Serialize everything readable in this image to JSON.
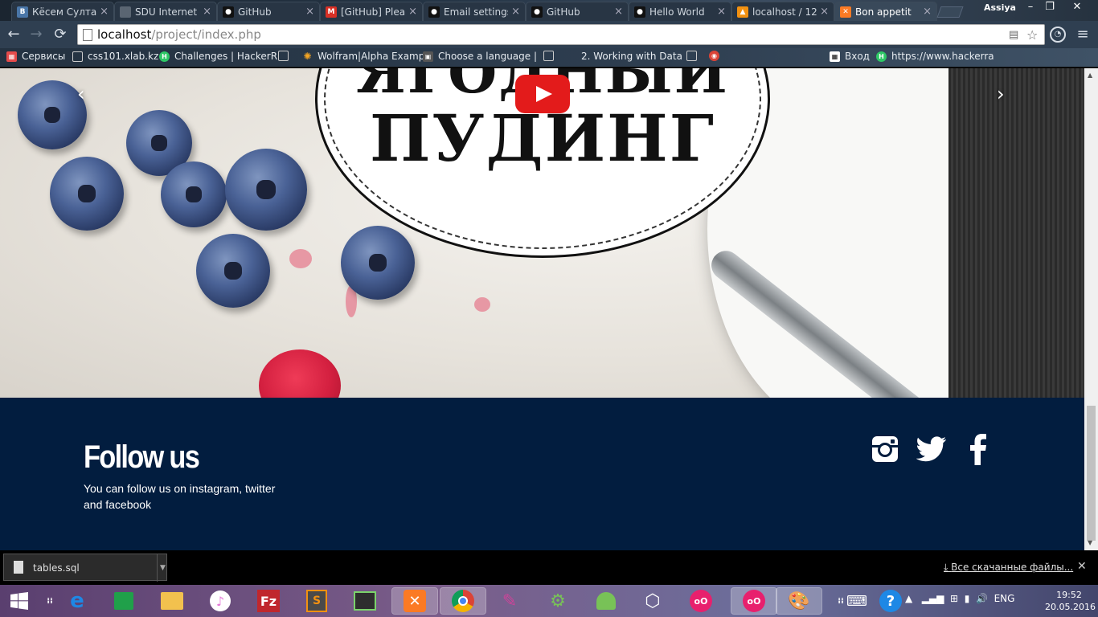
{
  "browser": {
    "tabs": [
      {
        "title": "Кёсем Султан",
        "icon": "vk-icon",
        "color": "#4a76a8",
        "glyph": "B"
      },
      {
        "title": "SDU Internet",
        "icon": "page-icon",
        "color": "#777777",
        "glyph": ""
      },
      {
        "title": "GitHub",
        "icon": "github-icon",
        "color": "#333333",
        "glyph": "●"
      },
      {
        "title": "[GitHub] Please",
        "icon": "gmail-icon",
        "color": "#d93025",
        "glyph": "M"
      },
      {
        "title": "Email settings",
        "icon": "github-icon",
        "color": "#333333",
        "glyph": "●"
      },
      {
        "title": "GitHub",
        "icon": "github-icon",
        "color": "#333333",
        "glyph": "●"
      },
      {
        "title": "Hello World",
        "icon": "github-icon",
        "color": "#333333",
        "glyph": "●"
      },
      {
        "title": "localhost / 12",
        "icon": "phpmyadmin-icon",
        "color": "#f29111",
        "glyph": "▲"
      },
      {
        "title": "Bon appetit",
        "icon": "xampp-icon",
        "color": "#fb7a24",
        "glyph": "✕"
      }
    ],
    "user": "Assiya",
    "window_buttons": [
      "–",
      "❐",
      "✕"
    ],
    "nav": {
      "back": "←",
      "forward": "→",
      "reload": "⟳"
    },
    "address": {
      "host": "localhost",
      "path": "/project/index.php"
    },
    "bookmarks": [
      {
        "label": "Сервисы",
        "icon": "apps-grid-icon",
        "color": "#e54b4b",
        "glyph": "▦"
      },
      {
        "label": "css101.xlab.kz",
        "icon": "page-icon",
        "color": "#888888",
        "glyph": ""
      },
      {
        "label": "Challenges | HackerR",
        "icon": "hackerrank-icon",
        "color": "#2ec866",
        "glyph": "H"
      },
      {
        "label": "",
        "icon": "page-icon",
        "color": "#888888",
        "glyph": ""
      },
      {
        "label": "Wolfram|Alpha Examp",
        "icon": "wolfram-icon",
        "color": "#f5a623",
        "glyph": "✺"
      },
      {
        "label": "Choose a language |",
        "icon": "duolingo-book-icon",
        "color": "#666666",
        "glyph": "▣"
      },
      {
        "label": "",
        "icon": "page-icon",
        "color": "#888888",
        "glyph": ""
      },
      {
        "label": "2. Working with Data",
        "icon": "page-icon",
        "color": "#888888",
        "glyph": ""
      },
      {
        "label": "",
        "icon": "page-icon",
        "color": "#888888",
        "glyph": ""
      },
      {
        "label": "",
        "icon": "chrome-icon",
        "color": "#db4437",
        "glyph": "◉"
      },
      {
        "label": "Вход",
        "icon": "grid-icon",
        "color": "#333333",
        "glyph": "▦"
      },
      {
        "label": "https://www.hackerra",
        "icon": "hackerrank-icon",
        "color": "#2ec866",
        "glyph": "H"
      }
    ]
  },
  "page": {
    "hero": {
      "title_line1": "ЯГОДНЫЙ",
      "title_line2": "ПУДИНГ",
      "prev_arrow": "‹",
      "next_arrow": "›"
    },
    "footer": {
      "title": "Follow us",
      "text": "You can follow us on instagram, twitter and facebook",
      "social": [
        {
          "name": "instagram",
          "icon": "instagram-icon"
        },
        {
          "name": "twitter",
          "icon": "twitter-icon"
        },
        {
          "name": "facebook",
          "icon": "facebook-icon"
        }
      ]
    }
  },
  "downloads": {
    "file": "tables.sql",
    "show_all": "Все скачанные файлы...",
    "close": "✕"
  },
  "taskbar": {
    "apps": [
      {
        "name": "start",
        "icon": "windows-start-icon",
        "color": "#ffffff"
      },
      {
        "name": "task-view",
        "icon": "task-view-icon",
        "color": "#ffffff"
      },
      {
        "name": "internet-explorer",
        "icon": "ie-icon",
        "color": "#1e88e5"
      },
      {
        "name": "store",
        "icon": "store-icon",
        "color": "#20a04a"
      },
      {
        "name": "file-explorer",
        "icon": "folder-icon",
        "color": "#f2c14e"
      },
      {
        "name": "itunes",
        "icon": "itunes-icon",
        "color": "#e67ad8"
      },
      {
        "name": "filezilla",
        "icon": "filezilla-icon",
        "color": "#c0272d"
      },
      {
        "name": "sublime-text",
        "icon": "sublime-icon",
        "color": "#4a4a4a"
      },
      {
        "name": "terminal",
        "icon": "terminal-icon",
        "color": "#2e2e2e"
      },
      {
        "name": "xampp",
        "icon": "xampp-icon",
        "color": "#fb7a24"
      },
      {
        "name": "chrome",
        "icon": "chrome-icon",
        "color": "#db4437"
      },
      {
        "name": "paint-app",
        "icon": "paint-icon",
        "color": "#cc4499"
      },
      {
        "name": "android-studio",
        "icon": "android-studio-icon",
        "color": "#78c257"
      },
      {
        "name": "android",
        "icon": "android-icon",
        "color": "#78c257"
      },
      {
        "name": "virtualbox",
        "icon": "virtualbox-icon",
        "color": "#2d5fa3"
      },
      {
        "name": "flickr-like",
        "icon": "dots-icon",
        "color": "#e8206d"
      },
      {
        "name": "flickr-like-2",
        "icon": "dots-icon",
        "color": "#e8206d"
      },
      {
        "name": "paint",
        "icon": "palette-icon",
        "color": "#e0c090"
      }
    ],
    "tray": {
      "lang": "ENG",
      "time": "19:52",
      "date": "20.05.2016"
    }
  }
}
